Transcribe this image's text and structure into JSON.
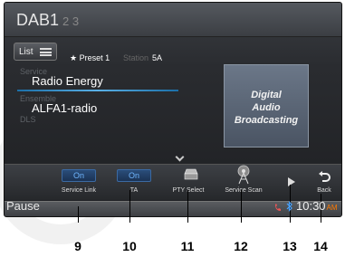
{
  "header": {
    "title": "DAB1",
    "pages": "2 3"
  },
  "list_button": {
    "label": "List",
    "icon": "list-icon"
  },
  "info": {
    "preset": "★ Preset 1",
    "station_label": "Station",
    "station_value": "5A",
    "service_label": "Service",
    "service_value": "Radio Energy",
    "ensemble_label": "Ensemble",
    "ensemble_value": "ALFA1-radio",
    "dls_label": "DLS"
  },
  "logo": {
    "line1": "Digital",
    "line2": "Audio",
    "line3": "Broadcasting"
  },
  "controls": {
    "service_link": {
      "state": "On",
      "label": "Service Link"
    },
    "ta": {
      "state": "On",
      "label": "TA"
    },
    "pty_select": {
      "label": "PTY Select"
    },
    "service_scan": {
      "label": "Service Scan"
    },
    "back": {
      "label": "Back"
    }
  },
  "status": {
    "playback": "Pause",
    "time": "10:30",
    "ampm": "AM"
  },
  "callouts": [
    "9",
    "10",
    "11",
    "12",
    "13",
    "14"
  ],
  "colors": {
    "accent_blue": "#5ab0e6",
    "toggle_text": "#6fb6ff",
    "ampm": "#ff7a00"
  }
}
